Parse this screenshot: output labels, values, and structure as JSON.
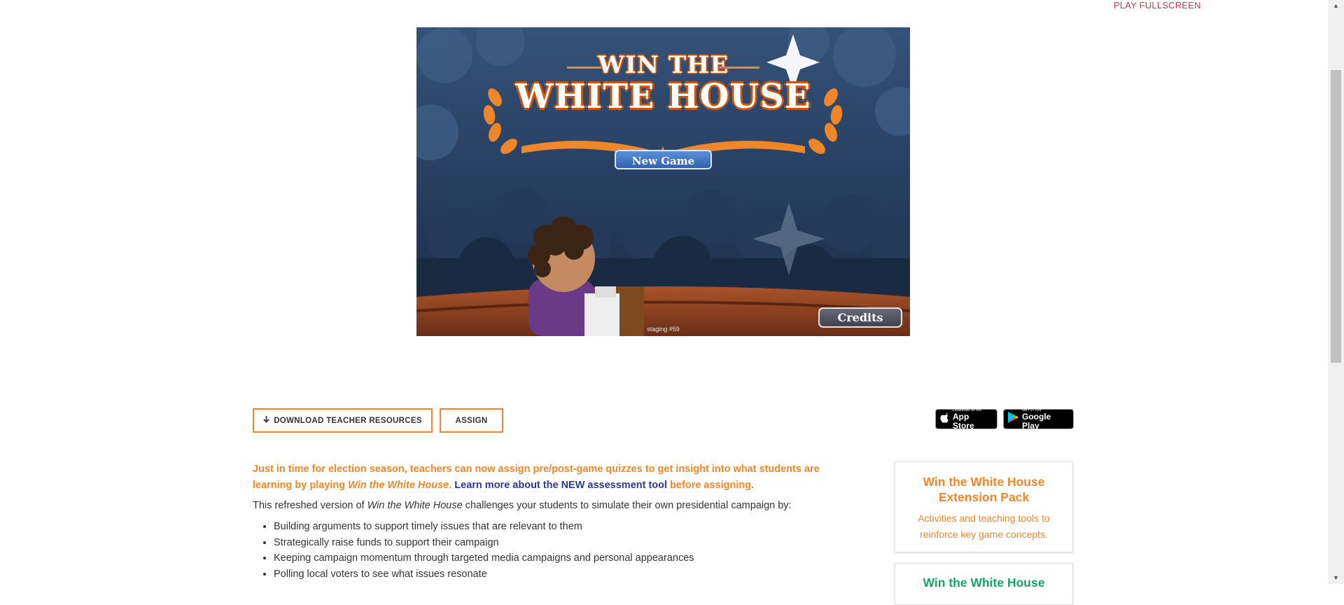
{
  "top_link": "PLAY FULLSCREEN",
  "game": {
    "logo_line1": "WIN THE",
    "logo_line2": "WHITE HOUSE",
    "new_game": "New Game",
    "credits": "Credits",
    "staging": "staging #59",
    "colors": {
      "orange": "#f0862a",
      "sky": "#2c4666",
      "button_blue": "#2f63b0"
    }
  },
  "actions": {
    "download_icon": "arrow-down-icon",
    "download": "DOWNLOAD TEACHER RESOURCES",
    "assign": "ASSIGN"
  },
  "stores": {
    "apple_small": "Download on the",
    "apple_big": "App Store",
    "google_small": "GET IT ON",
    "google_big": "Google Play"
  },
  "intro": {
    "text1": "Just in time for election season, teachers can now assign pre/post-game quizzes to get insight into what students are learning by playing ",
    "game_title": "Win the White House",
    "text2": ". ",
    "link": "Learn more about the NEW assessment tool",
    "text3": " before assigning."
  },
  "description": {
    "text1": "This refreshed version of ",
    "game_title": "Win the White House",
    "text2": " challenges your students to simulate their own presidential campaign by:"
  },
  "bullets": [
    "Building arguments to support timely issues that are relevant to them",
    "Strategically raise funds to support their campaign",
    "Keeping campaign momentum through targeted media campaigns and personal appearances",
    "Polling local voters to see what issues resonate"
  ],
  "sidebar": {
    "card1_title": "Win the White House Extension Pack",
    "card1_text": "Activities and teaching tools to reinforce key game concepts.",
    "card2_title": "Win the White House"
  }
}
